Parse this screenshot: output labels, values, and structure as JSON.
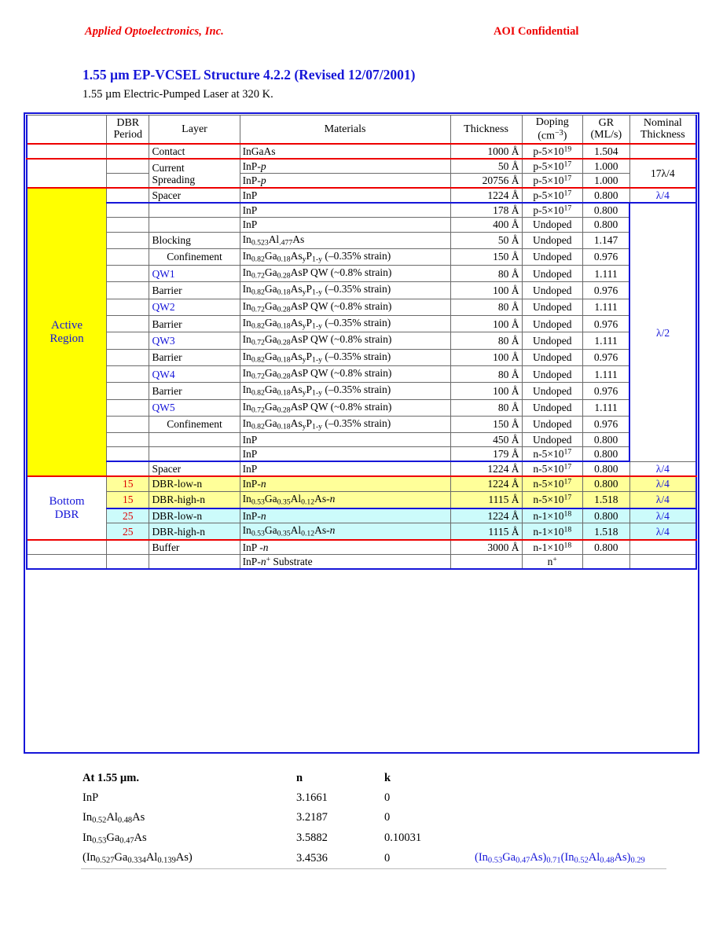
{
  "header": {
    "company": "Applied Optoelectronics, Inc.",
    "classification": "AOI Confidential"
  },
  "title": "1.55 µm EP-VCSEL Structure 4.2.2 (Revised 12/07/2001)",
  "subtitle": "1.55 µm Electric-Pumped Laser at 320 K.",
  "colors": {
    "header_red": "#ee0000",
    "title_blue": "#1616d8",
    "active_region_fill": "#ffff00",
    "dbr_15_fill": "#ffff99",
    "dbr_25_fill": "#ccfbfb",
    "period_red": "#dd0000"
  },
  "table": {
    "columns": [
      "",
      "DBR Period",
      "Layer",
      "Materials",
      "Thickness",
      "Doping (cm−3)",
      "GR (ML/s)",
      "Nominal Thickness"
    ],
    "headers": {
      "dbr_period_l1": "DBR",
      "dbr_period_l2": "Period",
      "layer": "Layer",
      "materials": "Materials",
      "thickness": "Thickness",
      "doping_l1": "Doping",
      "doping_l2": "(cm",
      "doping_exp": "−3",
      "doping_l2b": ")",
      "gr_l1": "GR",
      "gr_l2": "(ML/s)",
      "nominal_l1": "Nominal",
      "nominal_l2": "Thickness"
    },
    "groups": {
      "active_region_l1": "Active",
      "active_region_l2": "Region",
      "bottom_dbr_l1": "Bottom",
      "bottom_dbr_l2": "DBR"
    },
    "nominal": {
      "contact": "",
      "current_spreading": "17λ/4",
      "spacer_top": "λ/4",
      "active": "λ/2",
      "spacer_bottom": "λ/4",
      "dbr1": "λ/4",
      "dbr2": "λ/4",
      "dbr3": "λ/4",
      "dbr4": "λ/4"
    },
    "rows": [
      {
        "period": "",
        "layer": "Contact",
        "materials": "InGaAs",
        "thickness": "1000 Å",
        "doping": "p-5×10",
        "doping_exp": "19",
        "gr": "1.504"
      },
      {
        "period": "",
        "layer": "Current Spreading",
        "materials": "InP-p",
        "thickness": "50 Å",
        "doping": "p-5×10",
        "doping_exp": "17",
        "gr": "1.000"
      },
      {
        "period": "",
        "layer": "",
        "materials": "InP-p",
        "thickness": "20756 Å",
        "doping": "p-5×10",
        "doping_exp": "17",
        "gr": "1.000"
      },
      {
        "period": "",
        "layer": "Spacer",
        "materials": "InP",
        "thickness": "1224 Å",
        "doping": "p-5×10",
        "doping_exp": "17",
        "gr": "0.800"
      },
      {
        "period": "",
        "layer": "",
        "materials": "InP",
        "thickness": "178 Å",
        "doping": "p-5×10",
        "doping_exp": "17",
        "gr": "0.800"
      },
      {
        "period": "",
        "layer": "",
        "materials": "InP",
        "thickness": "400 Å",
        "doping": "Undoped",
        "doping_exp": "",
        "gr": "0.800"
      },
      {
        "period": "",
        "layer": "Blocking",
        "materials": "In0.523Al.477As",
        "thickness": "50 Å",
        "doping": "Undoped",
        "doping_exp": "",
        "gr": "1.147"
      },
      {
        "period": "",
        "layer": "Confinement",
        "materials": "In0.82Ga0.18AsyP1-y (–0.35% strain)",
        "thickness": "150 Å",
        "doping": "Undoped",
        "doping_exp": "",
        "gr": "0.976"
      },
      {
        "period": "",
        "layer": "QW1",
        "materials": "In0.72Ga0.28AsP QW (~0.8% strain)",
        "thickness": "80 Å",
        "doping": "Undoped",
        "doping_exp": "",
        "gr": "1.111"
      },
      {
        "period": "",
        "layer": "Barrier",
        "materials": "In0.82Ga0.18AsyP1-y (–0.35% strain)",
        "thickness": "100 Å",
        "doping": "Undoped",
        "doping_exp": "",
        "gr": "0.976"
      },
      {
        "period": "",
        "layer": "QW2",
        "materials": "In0.72Ga0.28AsP QW (~0.8% strain)",
        "thickness": "80 Å",
        "doping": "Undoped",
        "doping_exp": "",
        "gr": "1.111"
      },
      {
        "period": "",
        "layer": "Barrier",
        "materials": "In0.82Ga0.18AsyP1-y (–0.35% strain)",
        "thickness": "100 Å",
        "doping": "Undoped",
        "doping_exp": "",
        "gr": "0.976"
      },
      {
        "period": "",
        "layer": "QW3",
        "materials": "In0.72Ga0.28AsP QW (~0.8% strain)",
        "thickness": "80 Å",
        "doping": "Undoped",
        "doping_exp": "",
        "gr": "1.111"
      },
      {
        "period": "",
        "layer": "Barrier",
        "materials": "In0.82Ga0.18AsyP1-y (–0.35% strain)",
        "thickness": "100 Å",
        "doping": "Undoped",
        "doping_exp": "",
        "gr": "0.976"
      },
      {
        "period": "",
        "layer": "QW4",
        "materials": "In0.72Ga0.28AsP QW (~0.8% strain)",
        "thickness": "80 Å",
        "doping": "Undoped",
        "doping_exp": "",
        "gr": "1.111"
      },
      {
        "period": "",
        "layer": "Barrier",
        "materials": "In0.82Ga0.18AsyP1-y (–0.35% strain)",
        "thickness": "100 Å",
        "doping": "Undoped",
        "doping_exp": "",
        "gr": "0.976"
      },
      {
        "period": "",
        "layer": "QW5",
        "materials": "In0.72Ga0.28AsP QW (~0.8% strain)",
        "thickness": "80 Å",
        "doping": "Undoped",
        "doping_exp": "",
        "gr": "1.111"
      },
      {
        "period": "",
        "layer": "Confinement",
        "materials": "In0.82Ga0.18AsyP1-y (–0.35% strain)",
        "thickness": "150 Å",
        "doping": "Undoped",
        "doping_exp": "",
        "gr": "0.976"
      },
      {
        "period": "",
        "layer": "",
        "materials": "InP",
        "thickness": "450 Å",
        "doping": "Undoped",
        "doping_exp": "",
        "gr": "0.800"
      },
      {
        "period": "",
        "layer": "",
        "materials": "InP",
        "thickness": "179 Å",
        "doping": "n-5×10",
        "doping_exp": "17",
        "gr": "0.800"
      },
      {
        "period": "",
        "layer": "Spacer",
        "materials": "InP",
        "thickness": "1224 Å",
        "doping": "n-5×10",
        "doping_exp": "17",
        "gr": "0.800"
      },
      {
        "period": "15",
        "layer": "DBR-low-n",
        "materials": "InP-n",
        "thickness": "1224 Å",
        "doping": "n-5×10",
        "doping_exp": "17",
        "gr": "0.800"
      },
      {
        "period": "15",
        "layer": "DBR-high-n",
        "materials": "In0.53Ga0.35Al0.12As-n",
        "thickness": "1115 Å",
        "doping": "n-5×10",
        "doping_exp": "17",
        "gr": "1.518"
      },
      {
        "period": "25",
        "layer": "DBR-low-n",
        "materials": "InP-n",
        "thickness": "1224 Å",
        "doping": "n-1×10",
        "doping_exp": "18",
        "gr": "0.800"
      },
      {
        "period": "25",
        "layer": "DBR-high-n",
        "materials": "In0.53Ga0.35Al0.12As-n",
        "thickness": "1115 Å",
        "doping": "n-1×10",
        "doping_exp": "18",
        "gr": "1.518"
      },
      {
        "period": "",
        "layer": "Buffer",
        "materials": "InP -n",
        "thickness": "3000 Å",
        "doping": "n-1×10",
        "doping_exp": "18",
        "gr": "0.800"
      },
      {
        "period": "",
        "layer": "",
        "materials": "InP-n+ Substrate",
        "thickness": "",
        "doping": "n+",
        "doping_exp": "",
        "gr": ""
      }
    ]
  },
  "index_table": {
    "header": {
      "label": "At 1.55 µm.",
      "n": "n",
      "k": "k",
      "note": ""
    },
    "rows": [
      {
        "material": "InP",
        "n": "3.1661",
        "k": "0",
        "note": ""
      },
      {
        "material": "In0.52Al0.48As",
        "n": "3.2187",
        "k": "0",
        "note": ""
      },
      {
        "material": "In0.53Ga0.47As",
        "n": "3.5882",
        "k": "0.10031",
        "note": ""
      },
      {
        "material": "(In0.527Ga0.334Al0.139As)",
        "n": "3.4536",
        "k": "0",
        "note": "(In0.53Ga0.47As)0.71(In0.52Al0.48As)0.29"
      }
    ]
  }
}
